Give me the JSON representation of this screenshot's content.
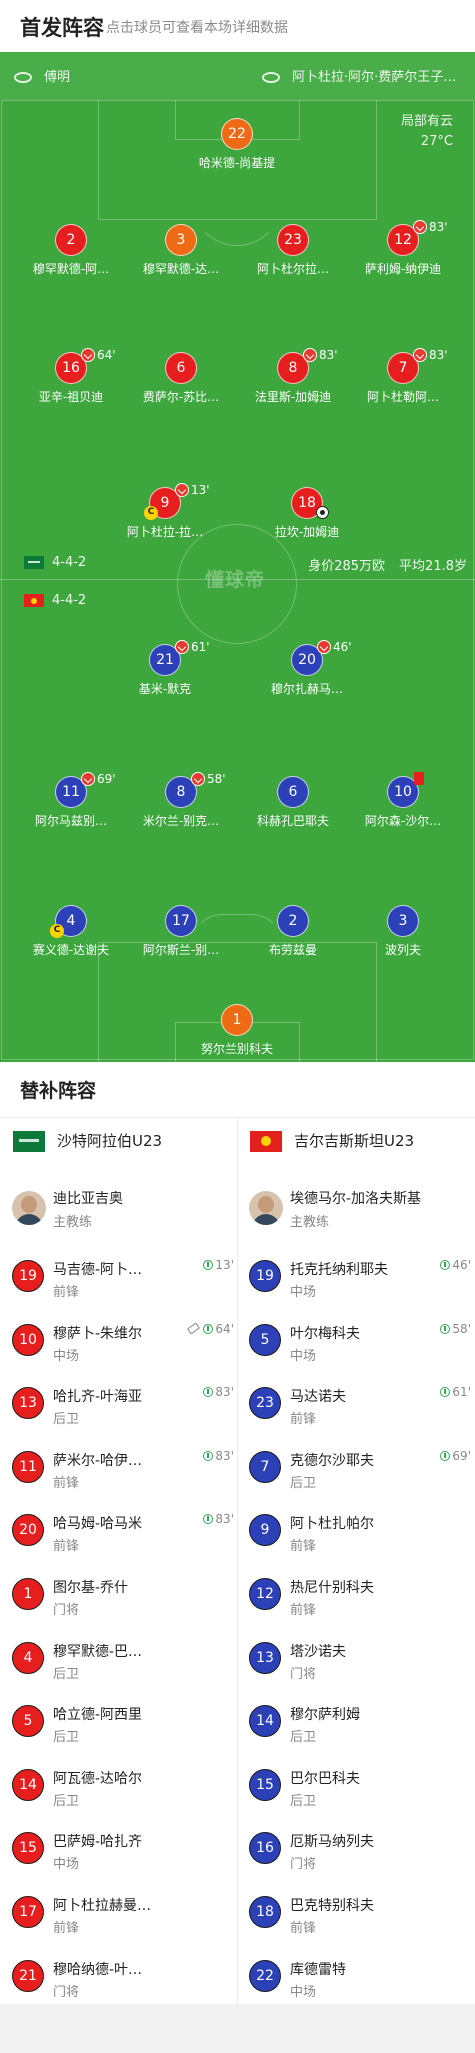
{
  "header": {
    "title": "首发阵容",
    "subtitle": "点击球员可查看本场详细数据"
  },
  "pitch": {
    "stadium": "傅明",
    "venue": "阿卜杜拉·阿尔·费萨尔王子…",
    "weather": "局部有云",
    "temperature": "27°C",
    "watermark": "懂球帝",
    "home_formation": "4-4-2",
    "away_formation": "4-4-2",
    "value": "身价285万欧",
    "avg_age": "平均21.8岁"
  },
  "home_lineup": [
    {
      "num": "22",
      "name": "哈米德-尚基提",
      "color": "orange"
    },
    {
      "num": "2",
      "name": "穆罕默德-阿…",
      "color": "red"
    },
    {
      "num": "3",
      "name": "穆罕默德-达…",
      "color": "orange"
    },
    {
      "num": "23",
      "name": "阿卜杜尔拉…",
      "color": "red"
    },
    {
      "num": "12",
      "name": "萨利姆-纳伊迪",
      "color": "red",
      "sub_min": "83'"
    },
    {
      "num": "16",
      "name": "亚辛-祖贝迪",
      "color": "red",
      "sub_min": "64'"
    },
    {
      "num": "6",
      "name": "费萨尔-苏比…",
      "color": "red"
    },
    {
      "num": "8",
      "name": "法里斯-加姆迪",
      "color": "red",
      "sub_min": "83'"
    },
    {
      "num": "7",
      "name": "阿卜杜勒阿…",
      "color": "red",
      "sub_min": "83'"
    },
    {
      "num": "9",
      "name": "阿卜杜拉-拉…",
      "color": "red",
      "sub_min": "13'",
      "captain": "C"
    },
    {
      "num": "18",
      "name": "拉坎-加姆迪",
      "color": "red",
      "goal": true
    }
  ],
  "away_lineup": [
    {
      "num": "21",
      "name": "基米-默克",
      "sub_min": "61'"
    },
    {
      "num": "20",
      "name": "穆尔扎赫马…",
      "sub_min": "46'"
    },
    {
      "num": "11",
      "name": "阿尔马兹别…",
      "sub_min": "69'"
    },
    {
      "num": "8",
      "name": "米尔兰-别克…",
      "sub_min": "58'"
    },
    {
      "num": "6",
      "name": "科赫孔巴耶夫"
    },
    {
      "num": "10",
      "name": "阿尔森-沙尔…",
      "red_card": true
    },
    {
      "num": "4",
      "name": "赛义德-达谢夫",
      "captain": "C"
    },
    {
      "num": "17",
      "name": "阿尔斯兰-别…"
    },
    {
      "num": "2",
      "name": "布劳兹曼"
    },
    {
      "num": "3",
      "name": "波列夫"
    },
    {
      "num": "1",
      "name": "努尔兰别科夫",
      "color": "orange"
    }
  ],
  "subs": {
    "title": "替补阵容",
    "home_team": "沙特阿拉伯U23",
    "away_team": "吉尔吉斯斯坦U23",
    "home_coach": {
      "name": "迪比亚吉奥",
      "role": "主教练"
    },
    "away_coach": {
      "name": "埃德马尔-加洛夫斯基",
      "role": "主教练"
    },
    "home": [
      {
        "num": "19",
        "name": "马吉德-阿卜…",
        "pos": "前锋",
        "time": "13'"
      },
      {
        "num": "10",
        "name": "穆萨卜-朱维尔",
        "pos": "中场",
        "time": "64'",
        "injury": true
      },
      {
        "num": "13",
        "name": "哈扎齐-叶海亚",
        "pos": "后卫",
        "time": "83'"
      },
      {
        "num": "11",
        "name": "萨米尔-哈伊…",
        "pos": "前锋",
        "time": "83'"
      },
      {
        "num": "20",
        "name": "哈马姆-哈马米",
        "pos": "前锋",
        "time": "83'"
      },
      {
        "num": "1",
        "name": "图尔基-乔什",
        "pos": "门将"
      },
      {
        "num": "4",
        "name": "穆罕默德-巴…",
        "pos": "后卫"
      },
      {
        "num": "5",
        "name": "哈立德-阿西里",
        "pos": "后卫"
      },
      {
        "num": "14",
        "name": "阿瓦德-达哈尔",
        "pos": "后卫"
      },
      {
        "num": "15",
        "name": "巴萨姆-哈扎齐",
        "pos": "中场"
      },
      {
        "num": "17",
        "name": "阿卜杜拉赫曼…",
        "pos": "前锋"
      },
      {
        "num": "21",
        "name": "穆哈纳德-叶…",
        "pos": "门将"
      }
    ],
    "away": [
      {
        "num": "19",
        "name": "托克托纳利耶夫",
        "pos": "中场",
        "time": "46'"
      },
      {
        "num": "5",
        "name": "叶尔梅科夫",
        "pos": "中场",
        "time": "58'"
      },
      {
        "num": "23",
        "name": "马达诺夫",
        "pos": "前锋",
        "time": "61'"
      },
      {
        "num": "7",
        "name": "克德尔沙耶夫",
        "pos": "后卫",
        "time": "69'"
      },
      {
        "num": "9",
        "name": "阿卜杜扎帕尔",
        "pos": "前锋"
      },
      {
        "num": "12",
        "name": "热尼什别科夫",
        "pos": "前锋"
      },
      {
        "num": "13",
        "name": "塔沙诺夫",
        "pos": "门将"
      },
      {
        "num": "14",
        "name": "穆尔萨利姆",
        "pos": "后卫"
      },
      {
        "num": "15",
        "name": "巴尔巴科夫",
        "pos": "后卫"
      },
      {
        "num": "16",
        "name": "厄斯马纳列夫",
        "pos": "门将"
      },
      {
        "num": "18",
        "name": "巴克特别科夫",
        "pos": "前锋"
      },
      {
        "num": "22",
        "name": "库德雷特",
        "pos": "中场"
      }
    ]
  }
}
